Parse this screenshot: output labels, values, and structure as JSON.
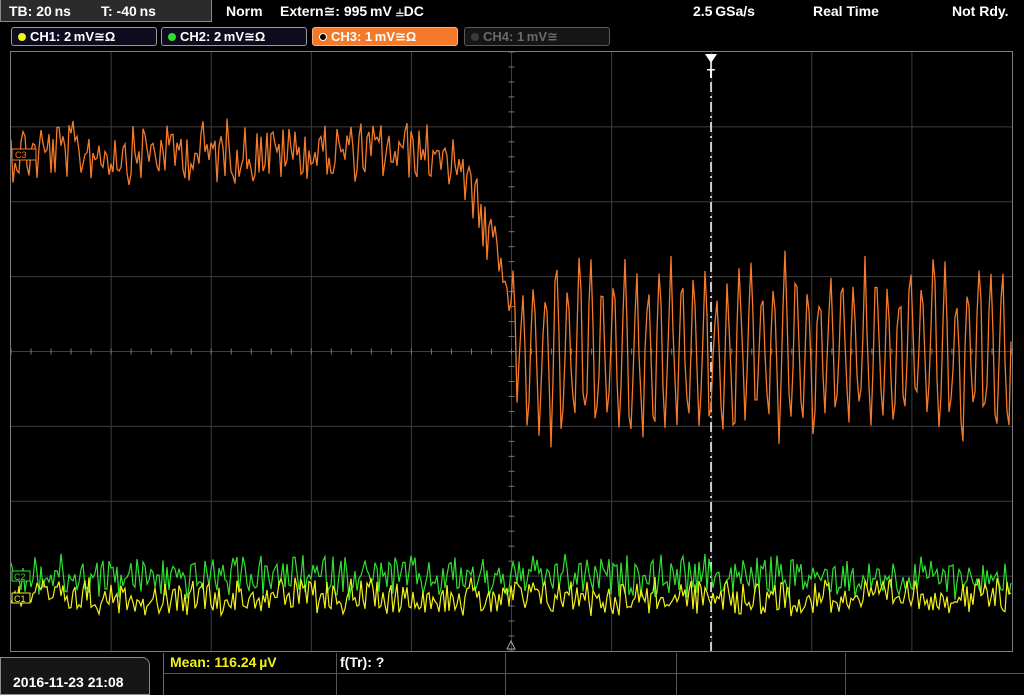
{
  "top": {
    "timebase": "TB: 20 ns",
    "trigger_time": "T: -40 ns",
    "trigger_mode": "Norm",
    "trigger_source": "Extern≅: 995 mV ⫨DC",
    "sample_rate": "2.5 GSa/s",
    "acq_mode": "Real Time",
    "status": "Not Rdy."
  },
  "channels": [
    {
      "label": "CH1: 2 mV≅Ω",
      "color": "#f2f21a",
      "state": "on"
    },
    {
      "label": "CH2: 2 mV≅Ω",
      "color": "#30e030",
      "state": "on"
    },
    {
      "label": "CH3: 1 mV≅Ω",
      "color": "#f47a2a",
      "state": "active"
    },
    {
      "label": "CH4: 1 mV≅",
      "color": "#5a5a5a",
      "state": "off"
    }
  ],
  "screen": {
    "trigger_marker": "T",
    "ch3_ref": "C3",
    "ch2_ref": "C2",
    "ch1_ref": "C1"
  },
  "bottom": {
    "datetime": "2016-11-23 21:08",
    "mean": "Mean: 116.24 µV",
    "ftr": "f(Tr): ?"
  },
  "colors": {
    "ch1": "#f2f21a",
    "ch2": "#30e030",
    "ch3": "#f47a2a",
    "grid": "#4a4a4a"
  }
}
